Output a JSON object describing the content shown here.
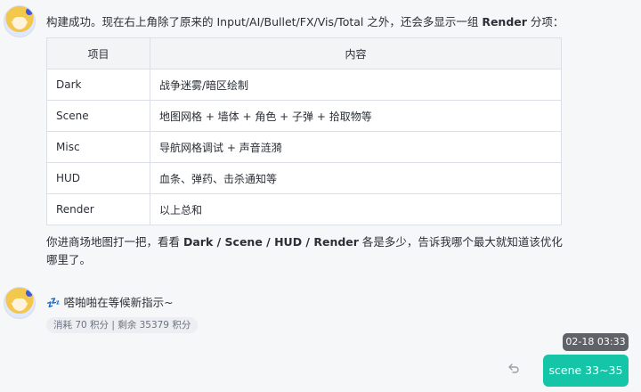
{
  "conversation": {
    "first_message": {
      "intro_prefix": "构建成功。现在右上角除了原来的 Input/AI/Bullet/FX/Vis/Total 之外，还会多显示一组 ",
      "intro_bold": "Render",
      "intro_suffix": " 分项：",
      "table": {
        "headers": [
          "项目",
          "内容"
        ],
        "rows": [
          [
            "Dark",
            "战争迷雾/暗区绘制"
          ],
          [
            "Scene",
            "地图网格 + 墙体 + 角色 + 子弹 + 拾取物等"
          ],
          [
            "Misc",
            "导航网格调试 + 声音涟漪"
          ],
          [
            "HUD",
            "血条、弹药、击杀通知等"
          ],
          [
            "Render",
            "以上总和"
          ]
        ]
      },
      "outro_prefix": "你进商场地图打一把，看看 ",
      "outro_bold": "Dark / Scene / HUD / Render",
      "outro_suffix": " 各是多少，告诉我哪个最大就知道该优化哪里了。"
    },
    "second_message": {
      "emoji": "💤",
      "text": "嗒啪啪在等候新指示~",
      "stats": "消耗 70 积分 | 剩余 35379 积分"
    },
    "user_message": {
      "timestamp": "02-18 03:33",
      "text": "scene 33~35"
    }
  },
  "icons": {
    "assistant_avatar": "assistant-avatar-icon",
    "undo": "undo-arrow-icon"
  },
  "colors": {
    "background": "#f6f7f9",
    "user_bubble": "#15c5a7",
    "timestamp_bg": "#5f6368"
  }
}
